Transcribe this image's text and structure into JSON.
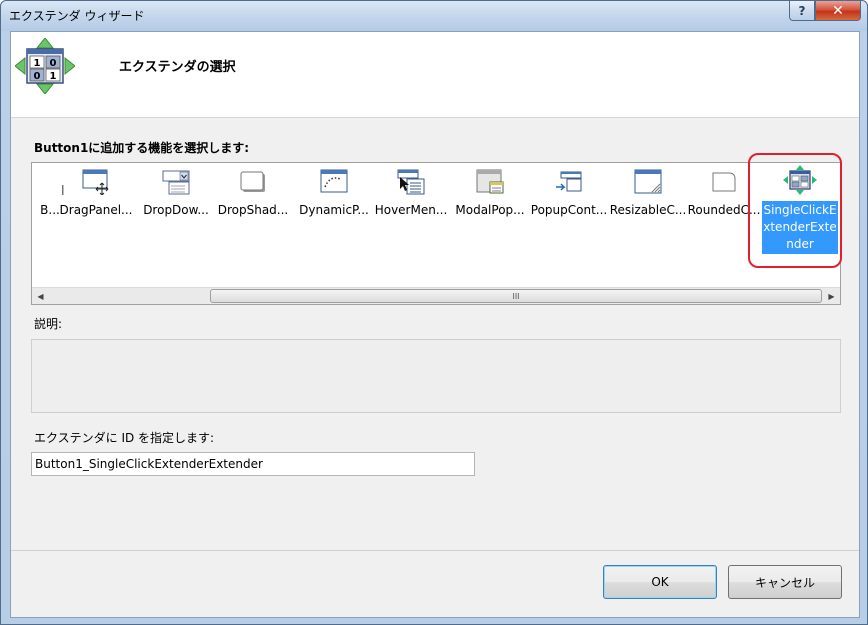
{
  "window": {
    "title": "エクステンダ ウィザード",
    "help_label": "?",
    "close_label": "✕"
  },
  "header": {
    "title": "エクステンダの選択",
    "icon": "wizard-binary-icon"
  },
  "section_label": "Button1に追加する機能を選択します:",
  "extenders": [
    {
      "label": "B...",
      "icon": "partial-icon"
    },
    {
      "label": "DragPanel...",
      "icon": "drag-panel-icon"
    },
    {
      "label": "DropDow...",
      "icon": "dropdown-icon"
    },
    {
      "label": "DropShad...",
      "icon": "drop-shadow-icon"
    },
    {
      "label": "DynamicP...",
      "icon": "dynamic-populate-icon"
    },
    {
      "label": "HoverMen...",
      "icon": "hover-menu-icon"
    },
    {
      "label": "ModalPop...",
      "icon": "modal-popup-icon"
    },
    {
      "label": "PopupCont...",
      "icon": "popup-control-icon"
    },
    {
      "label": "ResizableC...",
      "icon": "resizable-control-icon"
    },
    {
      "label": "RoundedC...",
      "icon": "rounded-corners-icon"
    },
    {
      "label": "SingleClickExtenderExtender",
      "icon": "single-click-extender-icon",
      "selected": true
    }
  ],
  "scrollbar": {
    "left_arrow": "◀",
    "right_arrow": "▶",
    "grip": "III"
  },
  "description_label": "説明:",
  "description_text": "",
  "id_label": "エクステンダに ID を指定します:",
  "id_value": "Button1_SingleClickExtenderExtender",
  "buttons": {
    "ok": "OK",
    "cancel": "キャンセル"
  },
  "colors": {
    "selection": "#3399ff",
    "highlight_ring": "#e0202e"
  }
}
